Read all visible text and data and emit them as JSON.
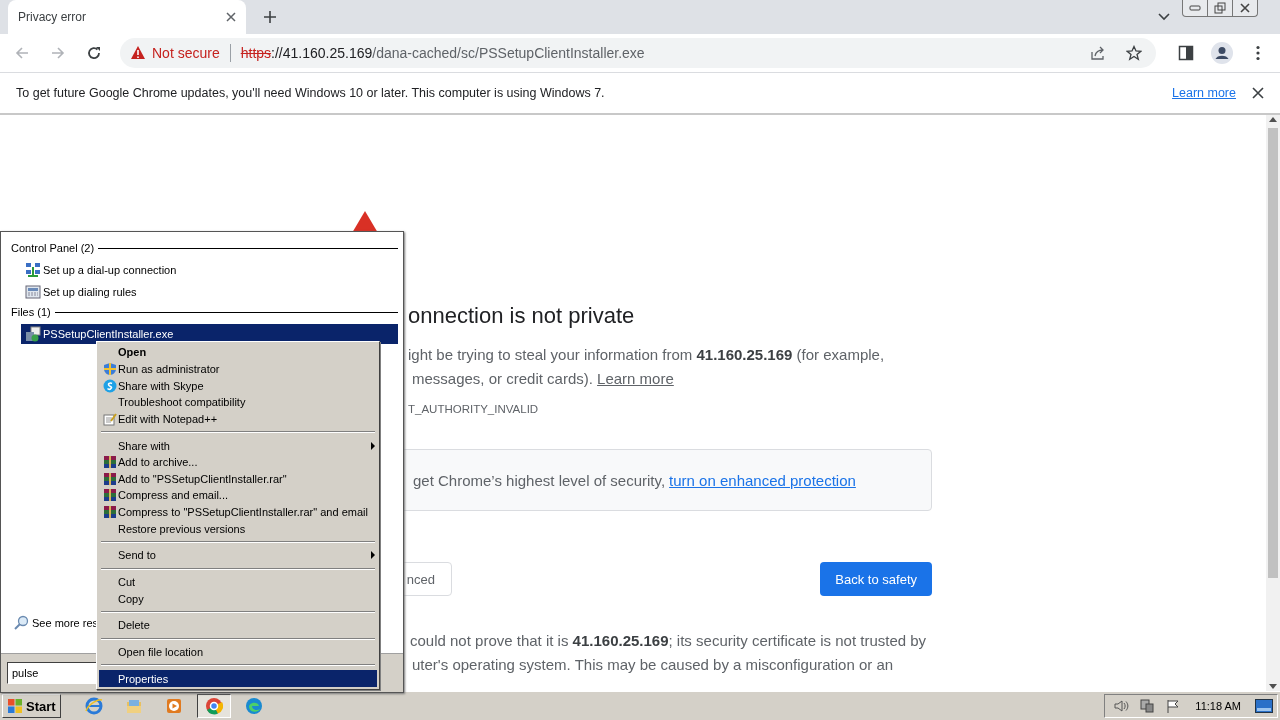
{
  "browser": {
    "tab": {
      "title": "Privacy error",
      "selected": true
    },
    "omnibox": {
      "security_label": "Not secure",
      "url_scheme": "https",
      "url_host": "://41.160.25.169",
      "url_path": "/dana-cached/sc/PSSetupClientInstaller.exe"
    }
  },
  "infobar": {
    "message": "To get future Google Chrome updates, you'll need Windows 10 or later. This computer is using Windows 7.",
    "link": "Learn more"
  },
  "page": {
    "heading": "onnection is not private",
    "intro_lines": [
      "ight be trying to steal your information from **41.160.25.169** (for example,",
      "messages, or credit cards)."
    ],
    "intro_link": "Learn more",
    "error_code": "T_AUTHORITY_INVALID",
    "protection": {
      "text": "get Chrome’s highest level of security,",
      "link": "turn on enhanced protection"
    },
    "advanced_button": "nced",
    "safety_button": "Back to safety",
    "details_lines": [
      "could not prove that it is **41.160.25.169**; its security certificate is not trusted by",
      "uter's operating system. This may be caused by a misconfiguration or an"
    ]
  },
  "start_menu": {
    "groups": [
      {
        "title": "Control Panel (2)",
        "items": [
          {
            "label": "Set up a dial-up connection",
            "selected": false
          },
          {
            "label": "Set up dialing rules",
            "selected": false
          }
        ]
      },
      {
        "title": "Files (1)",
        "items": [
          {
            "label": "PSSetupClientInstaller.exe",
            "selected": true
          }
        ]
      }
    ],
    "see_more": "See more res",
    "search": {
      "value": "pulse"
    }
  },
  "context_menu": [
    {
      "kind": "item",
      "label": "Open",
      "default": true,
      "selected": false
    },
    {
      "kind": "item",
      "label": "Run as administrator",
      "default": false,
      "selected": false
    },
    {
      "kind": "item",
      "label": "Share with Skype",
      "default": false,
      "selected": false
    },
    {
      "kind": "item",
      "label": "Troubleshoot compatibility",
      "default": false,
      "selected": false
    },
    {
      "kind": "item",
      "label": "Edit with Notepad++",
      "default": false,
      "selected": false
    },
    {
      "kind": "separator"
    },
    {
      "kind": "submenu",
      "label": "Share with",
      "default": false,
      "selected": false
    },
    {
      "kind": "item",
      "label": "Add to archive...",
      "default": false,
      "selected": false
    },
    {
      "kind": "item",
      "label": "Add to \"PSSetupClientInstaller.rar\"",
      "default": false,
      "selected": false
    },
    {
      "kind": "item",
      "label": "Compress and email...",
      "default": false,
      "selected": false
    },
    {
      "kind": "item",
      "label": "Compress to \"PSSetupClientInstaller.rar\" and email",
      "default": false,
      "selected": false
    },
    {
      "kind": "item",
      "label": "Restore previous versions",
      "default": false,
      "selected": false
    },
    {
      "kind": "separator"
    },
    {
      "kind": "submenu",
      "label": "Send to",
      "default": false,
      "selected": false
    },
    {
      "kind": "separator"
    },
    {
      "kind": "item",
      "label": "Cut",
      "default": false,
      "selected": false
    },
    {
      "kind": "item",
      "label": "Copy",
      "default": false,
      "selected": false
    },
    {
      "kind": "separator"
    },
    {
      "kind": "item",
      "label": "Delete",
      "default": false,
      "selected": false
    },
    {
      "kind": "separator"
    },
    {
      "kind": "item",
      "label": "Open file location",
      "default": false,
      "selected": false
    },
    {
      "kind": "separator"
    },
    {
      "kind": "item",
      "label": "Properties",
      "default": false,
      "selected": true
    }
  ],
  "taskbar": {
    "start": "Start",
    "apps": [
      {
        "active": false
      },
      {
        "active": false
      },
      {
        "active": false
      },
      {
        "active": true
      },
      {
        "active": false
      }
    ],
    "clock": "11:18 AM"
  }
}
